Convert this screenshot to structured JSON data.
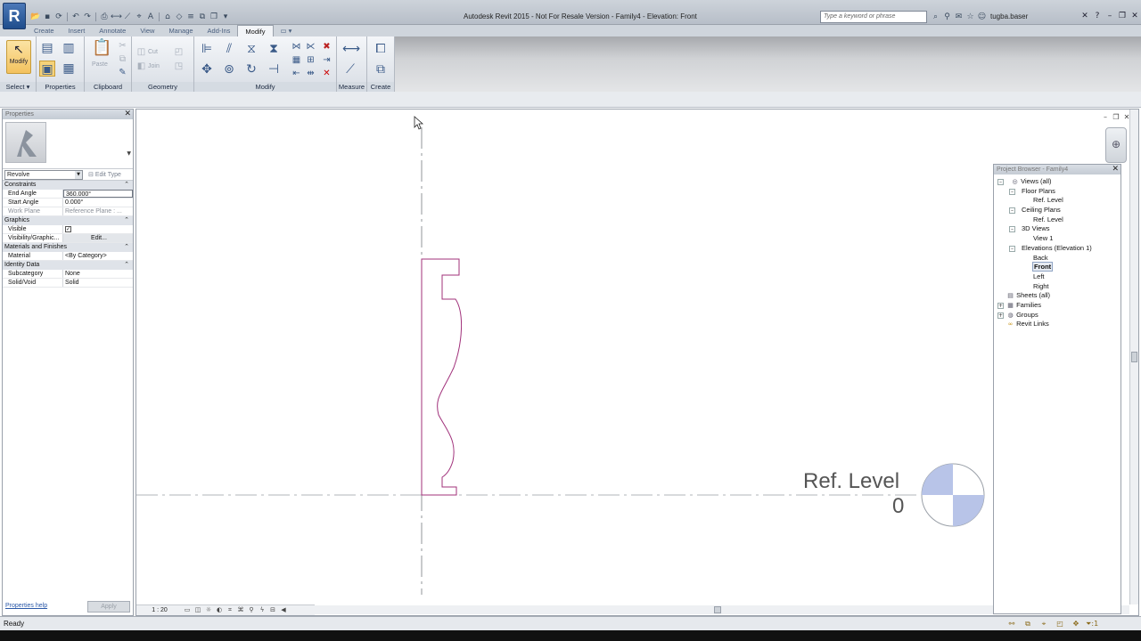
{
  "titlebar": {
    "app_letter": "R",
    "title": "Autodesk Revit 2015 - Not For Resale Version -    Family4 - Elevation: Front",
    "search_placeholder": "Type a keyword or phrase",
    "user": "tugba.baser"
  },
  "tabs": [
    "Create",
    "Insert",
    "Annotate",
    "View",
    "Manage",
    "Add-Ins",
    "Modify"
  ],
  "ribbon": {
    "modify_label": "Modify",
    "select_label": "Select ▾",
    "properties_label": "Properties",
    "clipboard_label": "Clipboard",
    "paste_label": "Paste",
    "geometry_label": "Geometry",
    "cut_label": "Cut",
    "join_label": "Join",
    "modify_panel_label": "Modify",
    "measure_label": "Measure",
    "create_label": "Create"
  },
  "properties": {
    "title": "Properties",
    "instance_selector": "Revolve",
    "edit_type": "Edit Type",
    "groups": [
      {
        "name": "Constraints",
        "rows": [
          {
            "key": "End Angle",
            "value": "360.000°"
          },
          {
            "key": "Start Angle",
            "value": "0.000°"
          },
          {
            "key": "Work Plane",
            "value": "Reference Plane : ..."
          }
        ]
      },
      {
        "name": "Graphics",
        "rows": [
          {
            "key": "Visible",
            "value": "✓"
          },
          {
            "key": "Visibility/Graphic...",
            "value": "Edit..."
          }
        ]
      },
      {
        "name": "Materials and Finishes",
        "rows": [
          {
            "key": "Material",
            "value": "<By Category>"
          }
        ]
      },
      {
        "name": "Identity Data",
        "rows": [
          {
            "key": "Subcategory",
            "value": "None"
          },
          {
            "key": "Solid/Void",
            "value": "Solid"
          }
        ]
      }
    ],
    "help_link": "Properties help",
    "apply_label": "Apply"
  },
  "canvas": {
    "level_name": "Ref. Level",
    "level_elevation": "0",
    "scale": "1 : 20"
  },
  "browser": {
    "title": "Project Browser - Family4",
    "nodes": [
      {
        "label": "Views (all)"
      },
      {
        "label": "Floor Plans"
      },
      {
        "label": "Ref. Level"
      },
      {
        "label": "Ceiling Plans"
      },
      {
        "label": "Ref. Level"
      },
      {
        "label": "3D Views"
      },
      {
        "label": "View 1"
      },
      {
        "label": "Elevations (Elevation 1)"
      },
      {
        "label": "Back"
      },
      {
        "label": "Front"
      },
      {
        "label": "Left"
      },
      {
        "label": "Right"
      },
      {
        "label": "Sheets (all)"
      },
      {
        "label": "Families"
      },
      {
        "label": "Groups"
      },
      {
        "label": "Revit Links"
      }
    ]
  },
  "status": {
    "text": "Ready",
    "filter_count": ":1"
  },
  "colors": {
    "profile": "#a0307a",
    "level_target_fill": "#b8c4e8",
    "ribbon_active": "#f3c25e"
  }
}
